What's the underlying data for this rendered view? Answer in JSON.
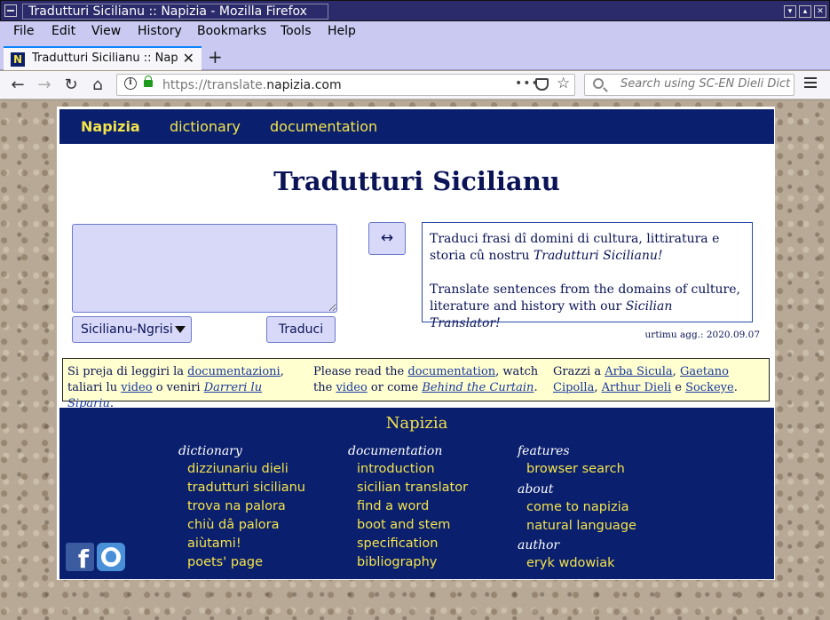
{
  "window": {
    "title": "Tradutturi Sicilianu :: Napizia - Mozilla Firefox"
  },
  "menu": {
    "items": [
      "File",
      "Edit",
      "View",
      "History",
      "Bookmarks",
      "Tools",
      "Help"
    ]
  },
  "tab": {
    "title": "Tradutturi Sicilianu :: Napizia",
    "favicon_letter": "N"
  },
  "urlbar": {
    "prefix": "https://translate.",
    "domain": "napizia.com",
    "dots": "•••"
  },
  "searchbar": {
    "placeholder": "Search using SC-EN Dieli Dict"
  },
  "page": {
    "nav": {
      "brand": "Napizia",
      "dictionary": "dictionary",
      "documentation": "documentation"
    },
    "heading": "Tradutturi Sicilianu",
    "textarea_value": "",
    "language_select": "Sicilianu-Ngrisi",
    "translate_button": "Traduci",
    "swap_symbol": "↔",
    "info": {
      "sc_text": "Traduci frasi dî domini di cultura, littiratura e storia cû nostru ",
      "sc_emph": "Tradutturi Sicilianu!",
      "en_text": "Translate sentences from the domains of culture, literature and history with our ",
      "en_emph": "Sicilian Translator!"
    },
    "updated": "urtimu agg.: 2020.09.07",
    "notice": {
      "sc": {
        "t1": "Si preja di leggiri la ",
        "l1": "documentazioni",
        "t2": ", taliari lu ",
        "l2": "video",
        "t3": " o veniri ",
        "l3": "Darreri lu Sipariu",
        "t4": "."
      },
      "en": {
        "t1": "Please read the ",
        "l1": "documentation",
        "t2": ", watch the ",
        "l2": "video",
        "t3": " or come ",
        "l3": "Behind the Curtain",
        "t4": "."
      },
      "thanks": {
        "t1": "Grazzi a ",
        "l1": "Arba Sicula",
        "t2": ", ",
        "l2": "Gaetano Cipolla",
        "t3": ", ",
        "l3": "Arthur Dieli",
        "t4": " e ",
        "l4": "Sockeye",
        "t5": "."
      }
    },
    "footer": {
      "title": "Napizia",
      "dictionary_head": "dictionary",
      "dictionary_links": [
        "dizziunariu dieli",
        "tradutturi sicilianu",
        "trova na palora",
        "chiù dâ palora",
        "aiùtami!",
        "poets' page"
      ],
      "documentation_head": "documentation",
      "documentation_links": [
        "introduction",
        "sicilian translator",
        "find a word",
        "boot and stem",
        "specification",
        "bibliography"
      ],
      "features_head": "features",
      "features_links": [
        "browser search"
      ],
      "about_head": "about",
      "about_links": [
        "come to napizia",
        "natural language"
      ],
      "author_head": "author",
      "author_links": [
        "eryk wdowiak"
      ],
      "facebook_letter": "f"
    }
  }
}
